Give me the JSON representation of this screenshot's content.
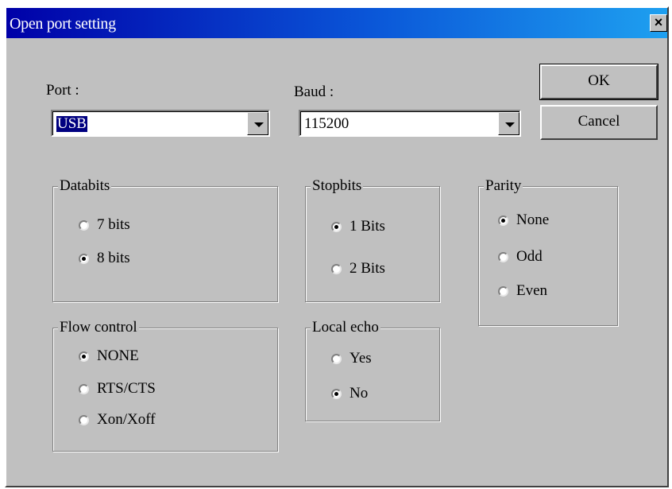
{
  "window": {
    "title": "Open port setting",
    "close_label": "×"
  },
  "port": {
    "label": "Port :",
    "value": "USB"
  },
  "baud": {
    "label": "Baud :",
    "value": "115200"
  },
  "buttons": {
    "ok": "OK",
    "cancel": "Cancel"
  },
  "databits": {
    "title": "Databits",
    "options": [
      "7 bits",
      "8 bits"
    ],
    "selected": "8 bits"
  },
  "stopbits": {
    "title": "Stopbits",
    "options": [
      "1 Bits",
      "2 Bits"
    ],
    "selected": "1 Bits"
  },
  "parity": {
    "title": "Parity",
    "options": [
      "None",
      "Odd",
      "Even"
    ],
    "selected": "None"
  },
  "flow": {
    "title": "Flow control",
    "options": [
      "NONE",
      "RTS/CTS",
      "Xon/Xoff"
    ],
    "selected": "NONE"
  },
  "echo": {
    "title": "Local echo",
    "options": [
      "Yes",
      "No"
    ],
    "selected": "No"
  },
  "colors": {
    "titlebar_start": "#0000a8",
    "titlebar_end": "#1ea0f0",
    "face": "#c0c0c0",
    "selection": "#000080"
  }
}
